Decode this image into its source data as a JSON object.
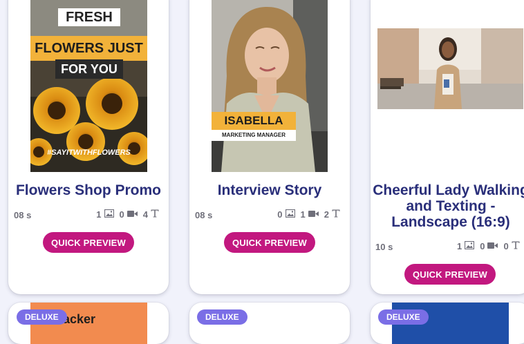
{
  "cards": [
    {
      "title": "Flowers Shop Promo",
      "duration": "08 s",
      "images": "1",
      "videos": "0",
      "texts": "4",
      "button": "QUICK PREVIEW",
      "thumb_text": {
        "line1": "FRESH",
        "line2": "FLOWERS JUST",
        "line3": "FOR YOU",
        "hashtag": "#SAYITWITHFLOWERS"
      }
    },
    {
      "title": "Interview Story",
      "duration": "08 s",
      "images": "0",
      "videos": "1",
      "texts": "2",
      "button": "QUICK PREVIEW",
      "thumb_text": {
        "name": "ISABELLA",
        "role": "MARKETING MANAGER"
      }
    },
    {
      "title_line1": "Cheerful Lady Walking",
      "title_line2": "and Texting -",
      "title_line3": "Landscape (16:9)",
      "duration": "10 s",
      "images": "1",
      "videos": "0",
      "texts": "0",
      "button": "QUICK PREVIEW"
    }
  ],
  "bottom_cards": [
    {
      "badge": "DELUXE",
      "thumb_text": "Tracker"
    },
    {
      "badge": "DELUXE"
    },
    {
      "badge": "DELUXE"
    }
  ],
  "colors": {
    "accent": "#c2187f",
    "title": "#2a2f7a",
    "badge": "#7a6ee6",
    "background": "#f1f2fb"
  },
  "icons": [
    "image-icon",
    "video-icon",
    "text-icon"
  ]
}
